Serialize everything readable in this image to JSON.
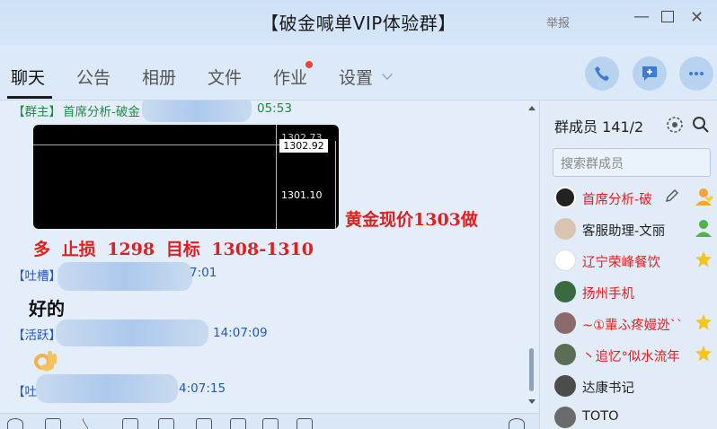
{
  "window": {
    "title": "【破金喊单VIP体验群】",
    "report_label": "举报",
    "minimize": "—",
    "close": "✕"
  },
  "tabs": [
    "聊天",
    "公告",
    "相册",
    "文件",
    "作业",
    "设置"
  ],
  "chat": {
    "messages": [
      {
        "role": "【群主】",
        "name": "首席分析-破金",
        "time": "05:53"
      },
      {
        "role": "【吐槽】",
        "time": "7:01",
        "text": "好的"
      },
      {
        "role": "【活跃】",
        "time": "14:07:09",
        "icon": "ok-hand-emoji"
      },
      {
        "role": "【吐",
        "time": "4:07:15"
      }
    ],
    "chart_image": {
      "price_top": "1302.92",
      "price_top_shadow": "1302.73",
      "price_bottom": "1301.10"
    },
    "red_line1": "黄金现价1303做",
    "red_line2": "多 止损 1298 目标 1308-1310"
  },
  "panel": {
    "title": "群成员 141/2",
    "search_placeholder": "搜索群成员",
    "members": [
      {
        "name": "首席分析-破",
        "color": "#e02020",
        "badge": "owner-badge-icon"
      },
      {
        "name": "客服助理-文丽",
        "color": "#222222",
        "badge": "admin-badge-icon"
      },
      {
        "name": "辽宁荣峰餐饮",
        "color": "#e02020",
        "badge": "star-badge-icon"
      },
      {
        "name": "扬州手机",
        "color": "#e02020",
        "badge": ""
      },
      {
        "name": "~①輩ふ疼嫚迯``",
        "color": "#e02020",
        "badge": "star-badge-icon"
      },
      {
        "name": "丶追忆°似水流年",
        "color": "#e02020",
        "badge": "star-badge-icon"
      },
      {
        "name": "达康书记",
        "color": "#222222",
        "badge": ""
      },
      {
        "name": "TOTO",
        "color": "#222222",
        "badge": ""
      }
    ]
  }
}
